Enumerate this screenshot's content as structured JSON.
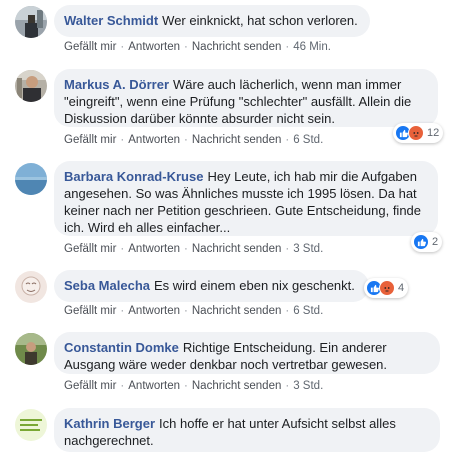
{
  "comments": [
    {
      "author": "Walter Schmidt",
      "text": "Wer einknickt, hat schon verloren.",
      "time": "46 Min.",
      "reaction_count": null
    },
    {
      "author": "Markus A. Dörrer",
      "text": "Wäre auch lächerlich, wenn man immer \"eingreift\", wenn eine Prüfung \"schlechter\" ausfällt. Allein die Diskussion darüber könnte absurder nicht sein.",
      "time": "6 Std.",
      "reaction_count": "12"
    },
    {
      "author": "Barbara Konrad-Kruse",
      "text": "Hey Leute, ich hab mir die Aufgaben angesehen. So was Ähnliches musste ich 1995 lösen. Da hat keiner nach ner Petition geschrieen. Gute Entscheidung, finde ich. Wird eh alles einfacher...",
      "time": "3 Std.",
      "reaction_count": "2"
    },
    {
      "author": "Seba Malecha",
      "text": "Es wird einem eben nix geschenkt.",
      "time": "6 Std.",
      "reaction_count": "4"
    },
    {
      "author": "Constantin Domke",
      "text": "Richtige Entscheidung. Ein anderer Ausgang wäre weder denkbar noch vertretbar gewesen.",
      "time": "3 Std.",
      "reaction_count": null
    },
    {
      "author": "Kathrin Berger",
      "text": "Ich hoffe er hat unter Aufsicht selbst alles nachgerechnet.",
      "time": "",
      "reaction_count": null
    }
  ],
  "actions": {
    "like": "Gefällt mir",
    "reply": "Antworten",
    "message": "Nachricht senden"
  },
  "colors": {
    "author": "#385898",
    "bubble": "#f0f2f5",
    "like": "#1877f2",
    "angry": "#e8613a"
  },
  "icons": [
    "like-reaction-icon",
    "angry-reaction-icon"
  ]
}
